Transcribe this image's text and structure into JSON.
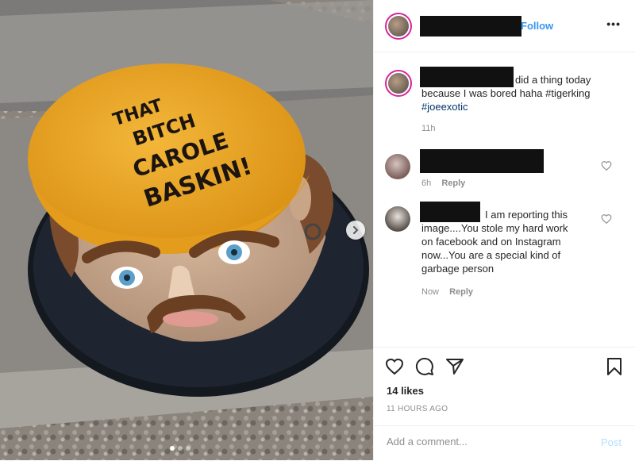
{
  "post": {
    "follow_label": "Follow",
    "more_label": "•••",
    "likes": "14 likes",
    "timestamp": "11 HOURS AGO",
    "comment_placeholder": "Add a comment...",
    "post_label": "Post"
  },
  "photo": {
    "cake_text": [
      "THAT",
      "BITCH",
      "CAROLE",
      "BASKIN!"
    ],
    "carousel_dots": 3
  },
  "comments": [
    {
      "lines": [
        "did a thing today",
        "because I was bored haha #tigerking",
        "#joeexotic"
      ],
      "time": "11h",
      "reply": ""
    },
    {
      "lines": [],
      "time": "6h",
      "reply": "Reply"
    },
    {
      "lines": [
        "I am reporting this",
        "image....You stole my hard work",
        "on facebook and on Instagram",
        "now...You are a special kind of",
        "garbage person"
      ],
      "time": "Now",
      "reply": "Reply"
    }
  ],
  "icons": {
    "heart": "heart-icon",
    "comment": "comment-icon",
    "share": "share-icon",
    "bookmark": "bookmark-icon",
    "next": "chevron-right-icon"
  },
  "colors": {
    "link_blue": "#3897f0",
    "post_disabled": "#b2dffc",
    "hashtag": "#003569"
  }
}
